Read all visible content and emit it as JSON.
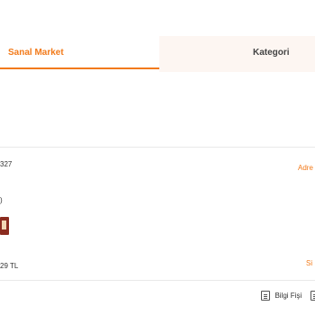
{
  "tabs": [
    {
      "label": "Sanal Market",
      "active": true
    },
    {
      "label": "Kategori",
      "active": false
    }
  ],
  "fragments": {
    "code": "327",
    "address_link": "Adre",
    "paren": ")",
    "price": "29 TL",
    "right_fragment": "Si",
    "info_label": "Bilgi Fişi"
  },
  "colors": {
    "accent": "#f27a1a",
    "tab_inactive_bg": "#fdf6f2",
    "divider": "#e9e9e9"
  },
  "icons": {
    "info": "document-icon",
    "info_trailing": "document-icon"
  }
}
